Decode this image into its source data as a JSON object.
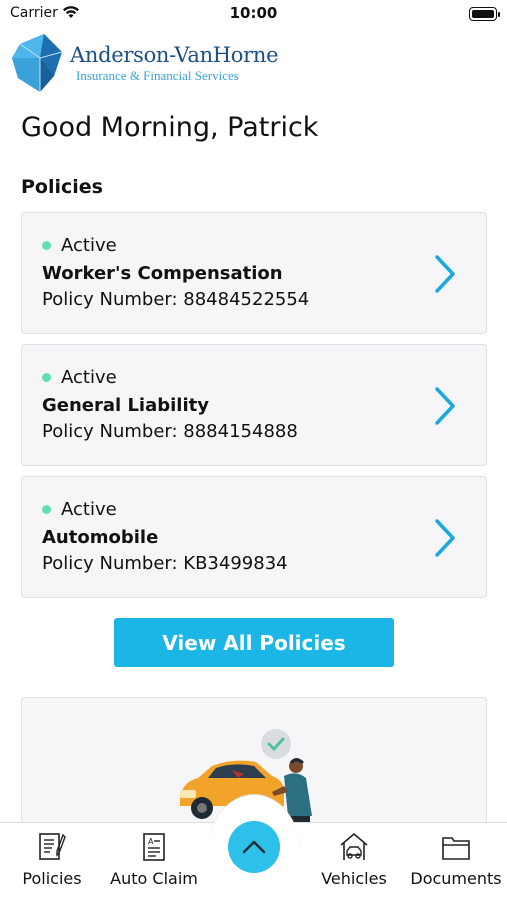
{
  "status_bar": {
    "carrier": "Carrier",
    "time": "10:00",
    "battery_level": 1.0
  },
  "brand": {
    "name": "Anderson-VanHorne",
    "tagline": "Insurance & Financial Services",
    "colors": {
      "navy": "#1c4f86",
      "blue": "#3aa2d8",
      "accent": "#1bb6e6"
    }
  },
  "greeting": "Good Morning, Patrick",
  "policies": {
    "title": "Policies",
    "items": [
      {
        "status": "Active",
        "name": "Worker's Compensation",
        "number": "Policy Number: 88484522554"
      },
      {
        "status": "Active",
        "name": "General Liability",
        "number": "Policy Number: 8884154888"
      },
      {
        "status": "Active",
        "name": "Automobile",
        "number": "Policy Number: KB3499834"
      }
    ],
    "view_all_label": "View All Policies",
    "status_color": "#5fe0b0"
  },
  "tab_bar": {
    "tabs": [
      {
        "label": "Policies",
        "icon": "document-edit-icon"
      },
      {
        "label": "Auto Claim",
        "icon": "claim-form-icon"
      },
      {
        "label": "",
        "icon": "chevron-up-icon"
      },
      {
        "label": "Vehicles",
        "icon": "garage-car-icon"
      },
      {
        "label": "Documents",
        "icon": "folder-icon"
      }
    ]
  }
}
